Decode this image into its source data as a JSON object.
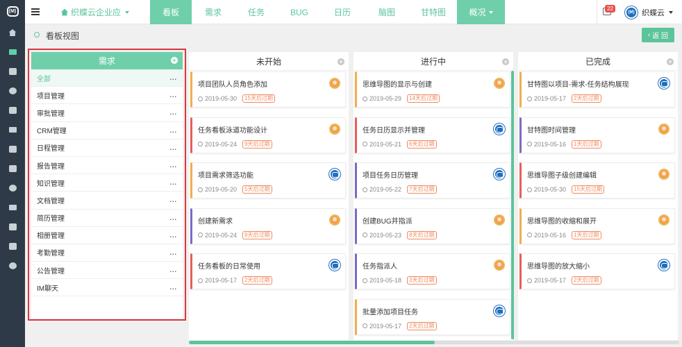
{
  "app": {
    "rail_icons": [
      "logo-icon",
      "home-icon",
      "list-icon",
      "briefcase-icon",
      "users-icon",
      "calendar-icon",
      "table-icon",
      "book-icon",
      "columns-icon",
      "person-icon",
      "image-icon",
      "megaphone-icon",
      "hammer-icon",
      "settings-icon"
    ],
    "logo_glyph": "(M)"
  },
  "topbar": {
    "brand": "织蝶云企业应",
    "tabs": [
      {
        "label": "看板",
        "active": true
      },
      {
        "label": "需求"
      },
      {
        "label": "任务"
      },
      {
        "label": "BUG"
      },
      {
        "label": "日历"
      },
      {
        "label": "脑图"
      },
      {
        "label": "甘特图"
      },
      {
        "label": "概况",
        "active": true,
        "dropdown": true
      }
    ],
    "notification_count": "22",
    "user_name": "织蝶云",
    "avatar_glyph": "(M)"
  },
  "subheader": {
    "title": "看板视图",
    "back_label": "返 回",
    "back_glyph": "‹"
  },
  "left_panel": {
    "title": "需求",
    "add_glyph": "+",
    "more_glyph": "...",
    "items": [
      "全部",
      "项目管理",
      "审批管理",
      "CRM管理",
      "日程管理",
      "报告管理",
      "知识管理",
      "文档管理",
      "简历管理",
      "相册管理",
      "考勤管理",
      "公告管理",
      "IM聊天"
    ]
  },
  "board": {
    "columns": [
      {
        "title": "未开始",
        "cards": [
          {
            "title": "项目团队人员角色添加",
            "date": "2019-05-30",
            "tag": "15天后过期",
            "accent": "#f0ad4e",
            "avatar": "orange"
          },
          {
            "title": "任务看板泳道功能设计",
            "date": "2019-05-24",
            "tag": "9天后过期",
            "accent": "#e85d5d",
            "avatar": "orange"
          },
          {
            "title": "项目需求筛选功能",
            "date": "2019-05-20",
            "tag": "5天后过期",
            "accent": "#f0ad4e",
            "avatar": "blue"
          },
          {
            "title": "创建新需求",
            "date": "2019-05-24",
            "tag": "9天后过期",
            "accent": "#7b6bc4",
            "avatar": "orange"
          },
          {
            "title": "任务看板的日常使用",
            "date": "2019-05-17",
            "tag": "2天后过期",
            "accent": "#e85d5d",
            "avatar": "blue"
          }
        ]
      },
      {
        "title": "进行中",
        "cards": [
          {
            "title": "思维导图的显示与创建",
            "date": "2019-05-29",
            "tag": "14天后过期",
            "accent": "#f0ad4e",
            "avatar": "orange"
          },
          {
            "title": "任务日历显示并管理",
            "date": "2019-05-21",
            "tag": "6天后过期",
            "accent": "#e85d5d",
            "avatar": "blue"
          },
          {
            "title": "项目任务日历管理",
            "date": "2019-05-22",
            "tag": "7天后过期",
            "accent": "#7b6bc4",
            "avatar": "blue"
          },
          {
            "title": "创建BUG并指派",
            "date": "2019-05-23",
            "tag": "8天后过期",
            "accent": "#7b6bc4",
            "avatar": "orange"
          },
          {
            "title": "任务指派人",
            "date": "2019-05-18",
            "tag": "3天后过期",
            "accent": "#7b6bc4",
            "avatar": "orange"
          },
          {
            "title": "批量添加项目任务",
            "date": "2019-05-17",
            "tag": "2天后过期",
            "accent": "#f0ad4e",
            "avatar": "blue"
          }
        ]
      },
      {
        "title": "已完成",
        "cards": [
          {
            "title": "甘特图以项目-需求-任务结构展现",
            "date": "2019-05-17",
            "tag": "2天后过期",
            "accent": "#f0ad4e",
            "avatar": "blue"
          },
          {
            "title": "甘特图时间管理",
            "date": "2019-05-16",
            "tag": "1天后过期",
            "accent": "#7b6bc4",
            "avatar": "orange"
          },
          {
            "title": "思维导图子级创建编辑",
            "date": "2019-05-30",
            "tag": "15天后过期",
            "accent": "#e85d5d",
            "avatar": "orange"
          },
          {
            "title": "思维导图的收缩和展开",
            "date": "2019-05-16",
            "tag": "1天后过期",
            "accent": "#f0ad4e",
            "avatar": "orange"
          },
          {
            "title": "思维导图的放大缩小",
            "date": "2019-05-17",
            "tag": "2天后过期",
            "accent": "#e85d5d",
            "avatar": "blue"
          }
        ]
      }
    ],
    "column_add_glyph": "+"
  }
}
